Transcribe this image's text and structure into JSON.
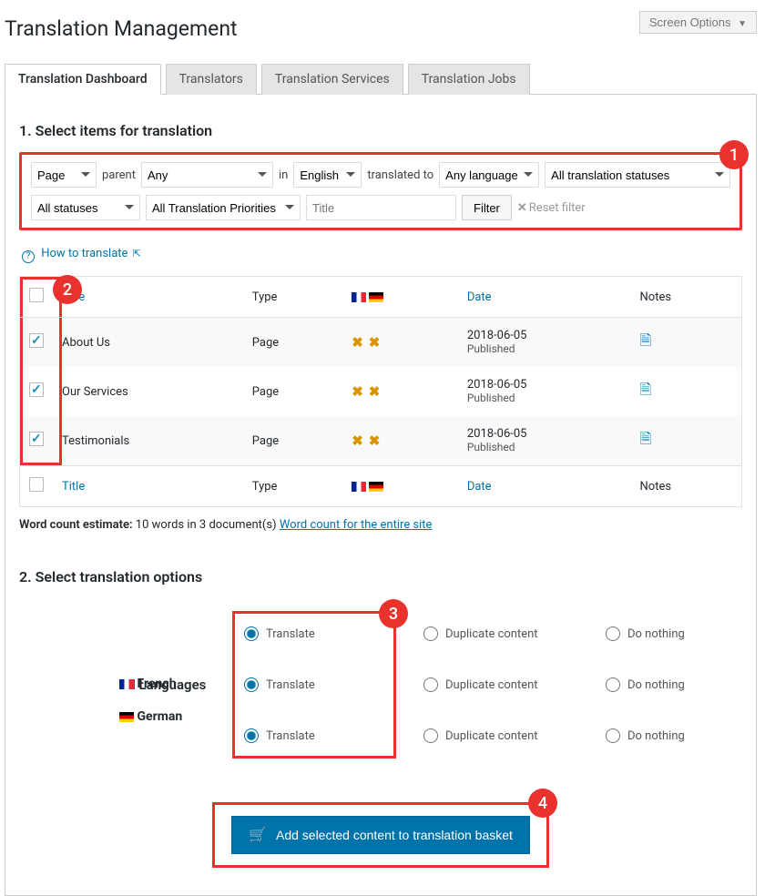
{
  "screen_options": "Screen Options",
  "title": "Translation Management",
  "tabs": [
    "Translation Dashboard",
    "Translators",
    "Translation Services",
    "Translation Jobs"
  ],
  "section1": {
    "heading": "1. Select items for translation",
    "type": "Page",
    "parent_lbl": "parent",
    "parent": "Any",
    "in_lbl": "in",
    "lang": "English",
    "to_lbl": "translated to",
    "to": "Any language",
    "trans_status": "All translation statuses",
    "status": "All statuses",
    "priority": "All Translation Priorities",
    "title_ph": "Title",
    "filter_btn": "Filter",
    "reset": "Reset filter"
  },
  "howto": "How to translate",
  "table": {
    "headers": {
      "title": "Title",
      "type": "Type",
      "date": "Date",
      "notes": "Notes"
    },
    "rows": [
      {
        "title": "About Us",
        "type": "Page",
        "date": "2018-06-05",
        "status": "Published"
      },
      {
        "title": "Our Services",
        "type": "Page",
        "date": "2018-06-05",
        "status": "Published"
      },
      {
        "title": "Testimonials",
        "type": "Page",
        "date": "2018-06-05",
        "status": "Published"
      }
    ]
  },
  "wc": {
    "label": "Word count estimate:",
    "text": "10 words in 3 document(s)",
    "link": "Word count for the entire site"
  },
  "section2": {
    "heading": "2. Select translation options",
    "all": "All Languages",
    "langs": [
      "French",
      "German"
    ],
    "translate": "Translate",
    "duplicate": "Duplicate content",
    "nothing": "Do nothing"
  },
  "basket": "Add selected content to translation basket",
  "badges": {
    "b1": "1",
    "b2": "2",
    "b3": "3",
    "b4": "4"
  }
}
